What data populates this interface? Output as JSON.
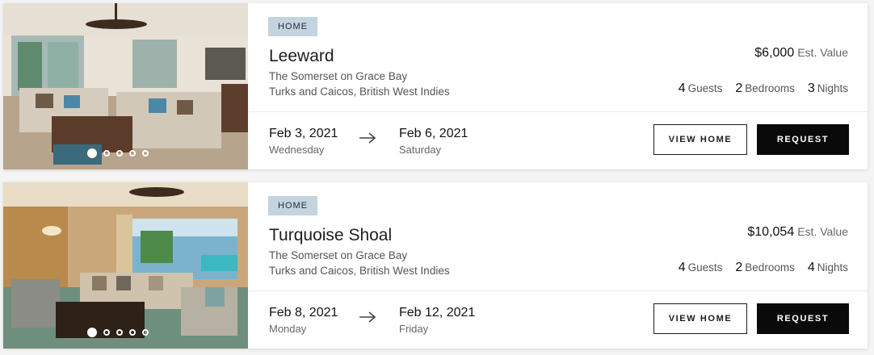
{
  "listings": [
    {
      "badge": "HOME",
      "title": "Leeward",
      "location_line1": "The Somerset on Grace Bay",
      "location_line2": "Turks and Caicos, British West Indies",
      "price": "$6,000",
      "price_suffix": "Est. Value",
      "guests": "4",
      "guests_label": "Guests",
      "bedrooms": "2",
      "bedrooms_label": "Bedrooms",
      "nights": "3",
      "nights_label": "Nights",
      "checkin_date": "Feb 3, 2021",
      "checkin_day": "Wednesday",
      "checkout_date": "Feb 6, 2021",
      "checkout_day": "Saturday",
      "view_label": "VIEW HOME",
      "request_label": "REQUEST",
      "photo_count": 5,
      "active_photo": 1
    },
    {
      "badge": "HOME",
      "title": "Turquoise Shoal",
      "location_line1": "The Somerset on Grace Bay",
      "location_line2": "Turks and Caicos, British West Indies",
      "price": "$10,054",
      "price_suffix": "Est. Value",
      "guests": "4",
      "guests_label": "Guests",
      "bedrooms": "2",
      "bedrooms_label": "Bedrooms",
      "nights": "4",
      "nights_label": "Nights",
      "checkin_date": "Feb 8, 2021",
      "checkin_day": "Monday",
      "checkout_date": "Feb 12, 2021",
      "checkout_day": "Friday",
      "view_label": "VIEW HOME",
      "request_label": "REQUEST",
      "photo_count": 5,
      "active_photo": 1
    }
  ],
  "icons": {
    "arrow": "arrow-right-icon"
  }
}
